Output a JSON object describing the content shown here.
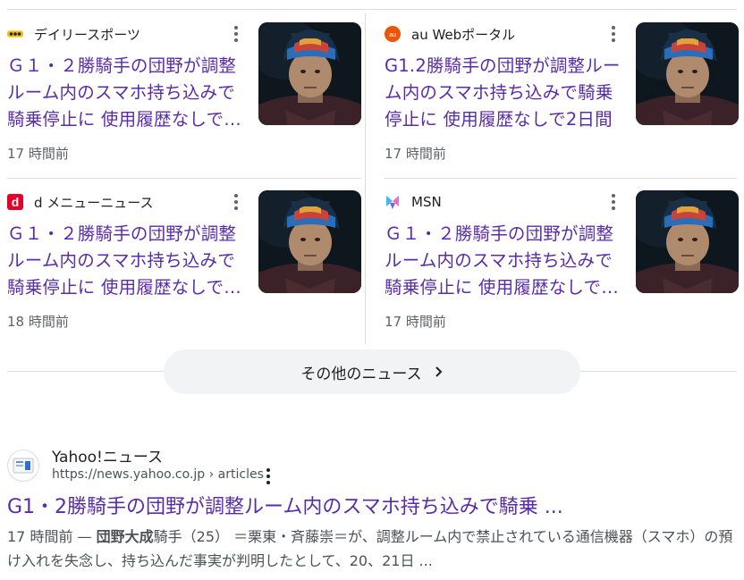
{
  "news_cards": [
    {
      "source": "デイリースポーツ",
      "icon": "daily-sports-logo",
      "title": "Ｇ１・２勝騎手の団野が調整ルーム内のスマホ持ち込みで騎乗停止に 使用履歴なしで…",
      "time": "17 時間前"
    },
    {
      "source": "au Webポータル",
      "icon": "au-web-portal-logo",
      "title": "G1.2勝騎手の団野が調整ルーム内のスマホ持ち込みで騎乗停止に 使用履歴なしで2日間",
      "time": "17 時間前"
    },
    {
      "source": "d メニューニュース",
      "icon": "d-menu-logo",
      "title": "Ｇ１・２勝騎手の団野が調整ルーム内のスマホ持ち込みで騎乗停止に 使用履歴なしで…",
      "time": "18 時間前"
    },
    {
      "source": "MSN",
      "icon": "msn-logo",
      "title": "Ｇ１・２勝騎手の団野が調整ルーム内のスマホ持ち込みで騎乗停止に 使用履歴なしで…",
      "time": "17 時間前"
    }
  ],
  "more_news": {
    "label": "その他のニュース",
    "icon": "chevron-right-icon"
  },
  "result": {
    "site_name": "Yahoo!ニュース",
    "url": "https://news.yahoo.co.jp › articles",
    "title": "G1・2勝騎手の団野が調整ルーム内のスマホ持ち込みで騎乗 ...",
    "snippet_time": "17 時間前 — ",
    "snippet_bold": "団野大成",
    "snippet_rest": "騎手（25） ＝栗東・斉藤崇＝が、調整ルーム内で禁止されている通信機器（スマホ）の預け入れを失念し、持ち込んだ事実が判明したとして、20、21日 ..."
  },
  "colors": {
    "link_visited": "#5a2ca9",
    "meta_text": "#5f6368",
    "divider": "#dadce0",
    "button_bg": "#f1f3f4"
  }
}
